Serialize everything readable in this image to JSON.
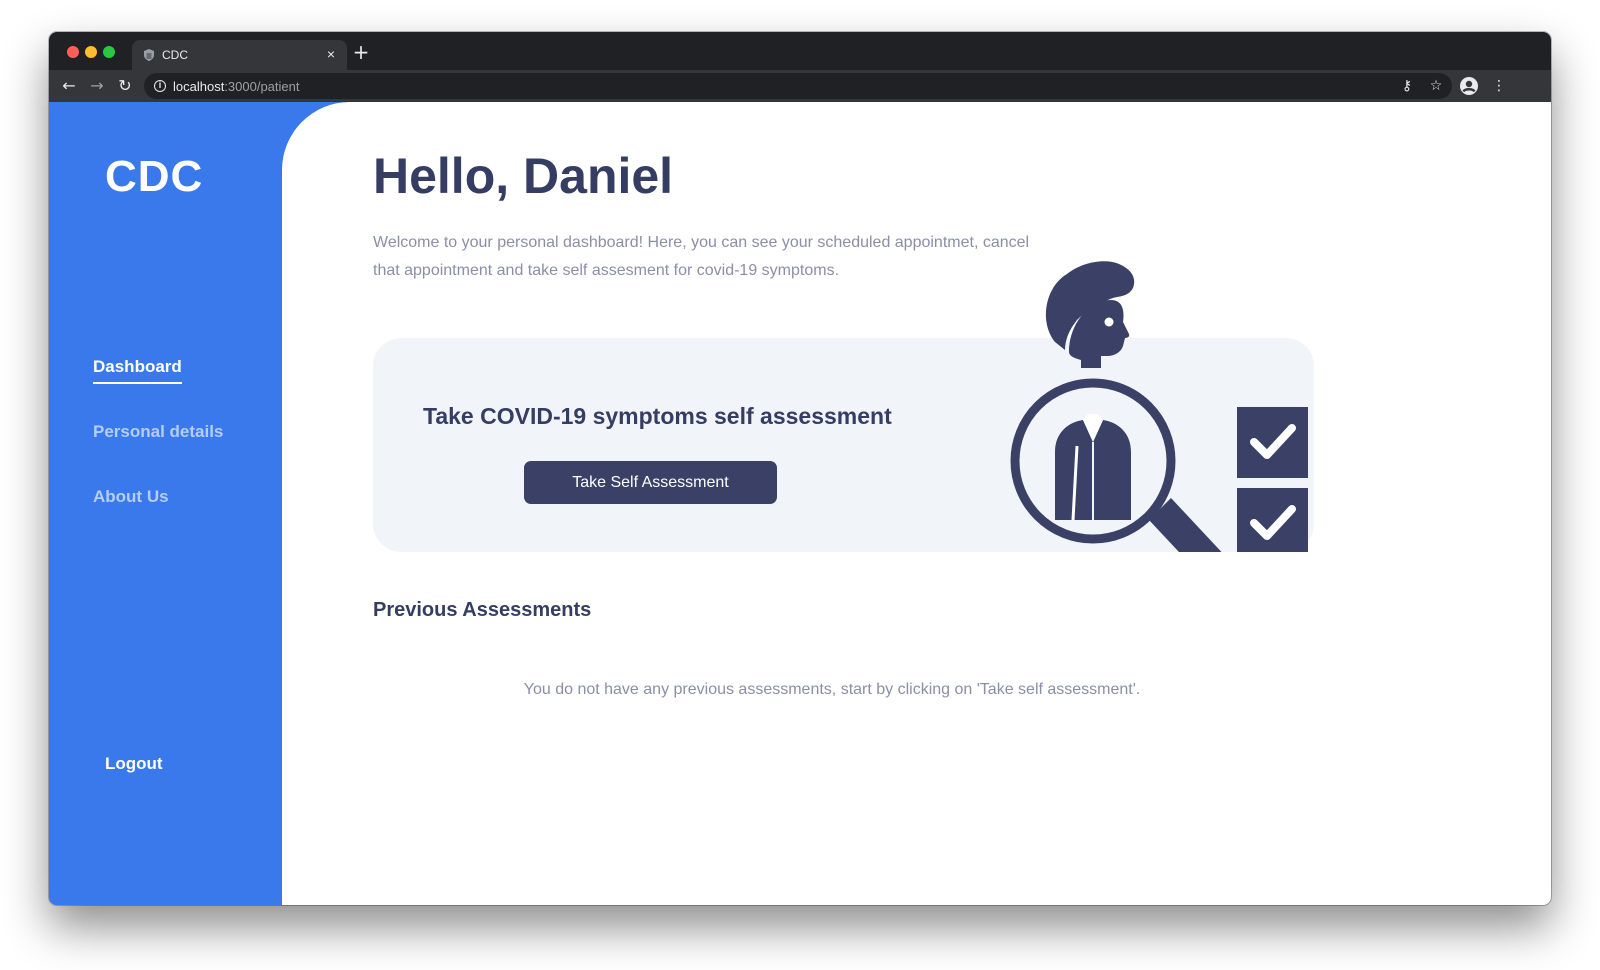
{
  "browser": {
    "tab_title": "CDC",
    "tab_close": "×",
    "new_tab": "+",
    "url_host": "localhost",
    "url_path": ":3000/patient"
  },
  "sidebar": {
    "logo": "CDC",
    "items": [
      {
        "label": "Dashboard",
        "active": true
      },
      {
        "label": "Personal details",
        "active": false
      },
      {
        "label": "About Us",
        "active": false
      }
    ],
    "logout": "Logout"
  },
  "main": {
    "greeting": "Hello, Daniel",
    "intro": "Welcome to your personal dashboard! Here, you can see your scheduled appointmet, cancel that appointment and take self assesment for covid-19 symptoms.",
    "card": {
      "title": "Take COVID-19 symptoms self assessment",
      "button": "Take Self Assessment"
    },
    "previous": {
      "title": "Previous Assessments",
      "empty": "You do not have any previous assessments, start by clicking on 'Take self assessment'."
    }
  },
  "colors": {
    "brand_blue": "#3a79ec",
    "navy": "#363d63",
    "card_bg": "#f1f5f9"
  },
  "icons": [
    "shield-favicon-icon",
    "close-icon",
    "plus-icon",
    "back-arrow-icon",
    "forward-arrow-icon",
    "reload-icon",
    "info-icon",
    "key-icon",
    "star-icon",
    "profile-icon",
    "kebab-menu-icon",
    "magnifier-person-checklist-illustration"
  ]
}
